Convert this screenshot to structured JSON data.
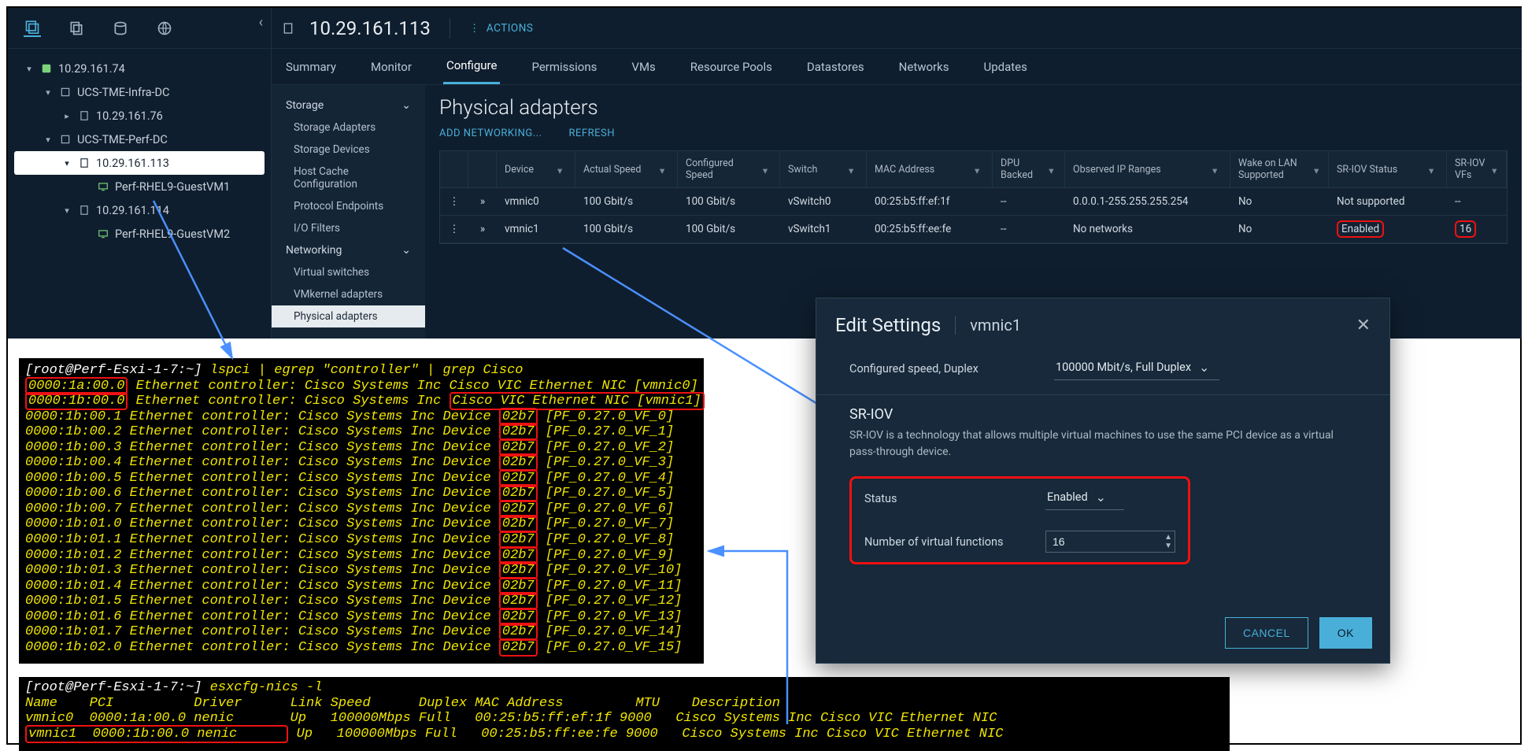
{
  "header": {
    "host_ip": "10.29.161.113",
    "actions_label": "ACTIONS"
  },
  "tabs": [
    "Summary",
    "Monitor",
    "Configure",
    "Permissions",
    "VMs",
    "Resource Pools",
    "Datastores",
    "Networks",
    "Updates"
  ],
  "active_tab": "Configure",
  "tree": {
    "root": "10.29.161.74",
    "dc1": "UCS-TME-Infra-DC",
    "host1": "10.29.161.76",
    "dc2": "UCS-TME-Perf-DC",
    "sel_host": "10.29.161.113",
    "vm1": "Perf-RHEL9-GuestVM1",
    "host2": "10.29.161.114",
    "vm2": "Perf-RHEL9-GuestVM2"
  },
  "config_sidebar": {
    "storage_label": "Storage",
    "storage_items": [
      "Storage Adapters",
      "Storage Devices",
      "Host Cache Configuration",
      "Protocol Endpoints",
      "I/O Filters"
    ],
    "networking_label": "Networking",
    "networking_items": [
      "Virtual switches",
      "VMkernel adapters",
      "Physical adapters"
    ]
  },
  "phys": {
    "title": "Physical adapters",
    "add_link": "ADD NETWORKING...",
    "refresh_link": "REFRESH",
    "headers": {
      "device": "Device",
      "actual_speed": "Actual Speed",
      "conf_speed": "Configured Speed",
      "switch": "Switch",
      "mac": "MAC Address",
      "dpu": "DPU Backed",
      "oip": "Observed IP Ranges",
      "wol": "Wake on LAN Supported",
      "sriov": "SR-IOV Status",
      "vfs": "SR-IOV VFs"
    },
    "rows": [
      {
        "device": "vmnic0",
        "actual": "100 Gbit/s",
        "conf": "100 Gbit/s",
        "switch": "vSwitch0",
        "mac": "00:25:b5:ff:ef:1f",
        "dpu": "--",
        "oip": "0.0.0.1-255.255.255.254",
        "wol": "No",
        "sriov": "Not supported",
        "vfs": "--"
      },
      {
        "device": "vmnic1",
        "actual": "100 Gbit/s",
        "conf": "100 Gbit/s",
        "switch": "vSwitch1",
        "mac": "00:25:b5:ff:ee:fe",
        "dpu": "--",
        "oip": "No networks",
        "wol": "No",
        "sriov": "Enabled",
        "vfs": "16"
      }
    ]
  },
  "dialog": {
    "title": "Edit Settings",
    "nic": "vmnic1",
    "speed_label": "Configured speed, Duplex",
    "speed_value": "100000 Mbit/s, Full Duplex",
    "sriov_head": "SR-IOV",
    "sriov_desc": "SR-IOV is a technology that allows multiple virtual machines to use the same PCI device as a virtual pass-through device.",
    "status_label": "Status",
    "status_value": "Enabled",
    "vf_label": "Number of virtual functions",
    "vf_value": "16",
    "cancel": "CANCEL",
    "ok": "OK"
  },
  "term1": {
    "prompt": "[root@Perf-Esxi-1-7:~] ",
    "cmd": "lspci | egrep \"controller\" | grep Cisco",
    "lines": [
      {
        "addr": "0000:1a:00.0",
        "rest": " Ethernet controller: Cisco Systems Inc ",
        "tail": "Cisco VIC Ethernet NIC [vmnic0]",
        "hl_addr": true,
        "hl_tail": false
      },
      {
        "addr": "0000:1b:00.0",
        "rest": " Ethernet controller: Cisco Systems Inc ",
        "tail": "Cisco VIC Ethernet NIC [vmnic1]",
        "hl_addr": true,
        "hl_tail": true
      },
      {
        "addr": "0000:1b:00.1",
        "rest": " Ethernet controller: Cisco Systems Inc Device ",
        "devid": "02b7",
        "vf": "[PF_0.27.0_VF_0]"
      },
      {
        "addr": "0000:1b:00.2",
        "rest": " Ethernet controller: Cisco Systems Inc Device ",
        "devid": "02b7",
        "vf": "[PF_0.27.0_VF_1]"
      },
      {
        "addr": "0000:1b:00.3",
        "rest": " Ethernet controller: Cisco Systems Inc Device ",
        "devid": "02b7",
        "vf": "[PF_0.27.0_VF_2]"
      },
      {
        "addr": "0000:1b:00.4",
        "rest": " Ethernet controller: Cisco Systems Inc Device ",
        "devid": "02b7",
        "vf": "[PF_0.27.0_VF_3]"
      },
      {
        "addr": "0000:1b:00.5",
        "rest": " Ethernet controller: Cisco Systems Inc Device ",
        "devid": "02b7",
        "vf": "[PF_0.27.0_VF_4]"
      },
      {
        "addr": "0000:1b:00.6",
        "rest": " Ethernet controller: Cisco Systems Inc Device ",
        "devid": "02b7",
        "vf": "[PF_0.27.0_VF_5]"
      },
      {
        "addr": "0000:1b:00.7",
        "rest": " Ethernet controller: Cisco Systems Inc Device ",
        "devid": "02b7",
        "vf": "[PF_0.27.0_VF_6]"
      },
      {
        "addr": "0000:1b:01.0",
        "rest": " Ethernet controller: Cisco Systems Inc Device ",
        "devid": "02b7",
        "vf": "[PF_0.27.0_VF_7]"
      },
      {
        "addr": "0000:1b:01.1",
        "rest": " Ethernet controller: Cisco Systems Inc Device ",
        "devid": "02b7",
        "vf": "[PF_0.27.0_VF_8]"
      },
      {
        "addr": "0000:1b:01.2",
        "rest": " Ethernet controller: Cisco Systems Inc Device ",
        "devid": "02b7",
        "vf": "[PF_0.27.0_VF_9]"
      },
      {
        "addr": "0000:1b:01.3",
        "rest": " Ethernet controller: Cisco Systems Inc Device ",
        "devid": "02b7",
        "vf": "[PF_0.27.0_VF_10]"
      },
      {
        "addr": "0000:1b:01.4",
        "rest": " Ethernet controller: Cisco Systems Inc Device ",
        "devid": "02b7",
        "vf": "[PF_0.27.0_VF_11]"
      },
      {
        "addr": "0000:1b:01.5",
        "rest": " Ethernet controller: Cisco Systems Inc Device ",
        "devid": "02b7",
        "vf": "[PF_0.27.0_VF_12]"
      },
      {
        "addr": "0000:1b:01.6",
        "rest": " Ethernet controller: Cisco Systems Inc Device ",
        "devid": "02b7",
        "vf": "[PF_0.27.0_VF_13]"
      },
      {
        "addr": "0000:1b:01.7",
        "rest": " Ethernet controller: Cisco Systems Inc Device ",
        "devid": "02b7",
        "vf": "[PF_0.27.0_VF_14]"
      },
      {
        "addr": "0000:1b:02.0",
        "rest": " Ethernet controller: Cisco Systems Inc Device ",
        "devid": "02b7",
        "vf": "[PF_0.27.0_VF_15]"
      }
    ]
  },
  "term2": {
    "prompt": "[root@Perf-Esxi-1-7:~] ",
    "cmd": "esxcfg-nics -l",
    "header": "Name    PCI          Driver      Link Speed      Duplex MAC Address         MTU    Description",
    "rows": [
      {
        "text": "vmnic0  0000:1a:00.0 nenic       Up   100000Mbps Full   00:25:b5:ff:ef:1f 9000   Cisco Systems Inc Cisco VIC Ethernet NIC",
        "hl": false
      },
      {
        "text": "vmnic1  0000:1b:00.0 nenic       Up   100000Mbps Full   00:25:b5:ff:ee:fe 9000   Cisco Systems Inc Cisco VIC Ethernet NIC",
        "hl": true,
        "hl_len": 32
      }
    ]
  }
}
